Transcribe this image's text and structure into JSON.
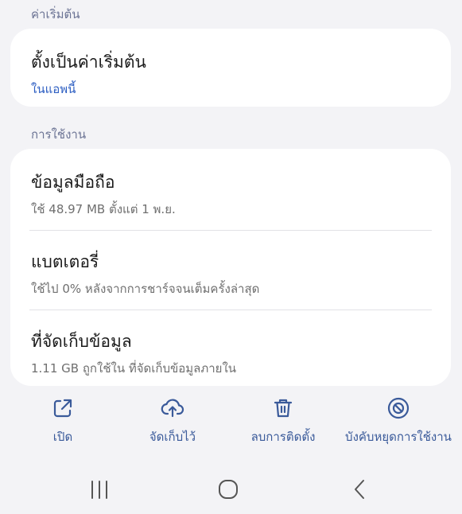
{
  "defaults": {
    "header": "ค่าเริ่มต้น",
    "item": {
      "title": "ตั้งเป็นค่าเริ่มต้น",
      "subtitle": "ในแอพนี้"
    }
  },
  "usage": {
    "header": "การใช้งาน",
    "items": [
      {
        "title": "ข้อมูลมือถือ",
        "subtitle": "ใช้ 48.97 MB ตั้งแต่ 1 พ.ย."
      },
      {
        "title": "แบตเตอรี่",
        "subtitle": "ใช้ไป 0% หลังจากการชาร์จจนเต็มครั้งล่าสุด"
      },
      {
        "title": "ที่จัดเก็บข้อมูล",
        "subtitle": "1.11 GB ถูกใช้ใน ที่จัดเก็บข้อมูลภายใน"
      }
    ]
  },
  "actions": [
    {
      "label": "เปิด",
      "icon": "open-external-icon"
    },
    {
      "label": "จัดเก็บไว้",
      "icon": "cloud-upload-icon"
    },
    {
      "label": "ลบการติดตั้ง",
      "icon": "trash-icon"
    },
    {
      "label": "บังคับหยุดการใช้งาน",
      "icon": "block-icon"
    }
  ],
  "navbar": {
    "recents_icon": "recents-icon",
    "home_icon": "home-icon",
    "back_icon": "back-icon"
  },
  "colors": {
    "background": "#f3f3f6",
    "card": "#ffffff",
    "accent": "#2d5ec2",
    "section_header": "#6b7394",
    "action": "#3a5a9a"
  }
}
